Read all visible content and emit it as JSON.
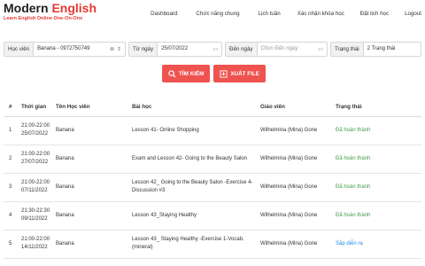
{
  "brand": {
    "title_main": "Modern",
    "title_accent": "English",
    "subtitle": "Learn English Online One-On-One"
  },
  "nav": [
    {
      "label": "Dashboard"
    },
    {
      "label": "Chức năng chung"
    },
    {
      "label": "Lịch tuần"
    },
    {
      "label": "Xác nhận khóa học"
    },
    {
      "label": "Đặt lịch học"
    },
    {
      "label": "Logout"
    }
  ],
  "filters": {
    "student_label": "Học viên",
    "student_value": "Banana - 0972750749",
    "from_label": "Từ ngày",
    "from_value": "25/07/2022",
    "to_label": "Đến ngày",
    "to_placeholder": "Chọn Đến ngày",
    "status_label": "Trạng thái",
    "status_value": "2 Trạng thái"
  },
  "actions": {
    "search_label": "TÌM KIẾM",
    "export_label": "XUẤT FILE"
  },
  "table": {
    "headers": {
      "num": "#",
      "time": "Thời gian",
      "student": "Tên Học viên",
      "lesson": "Bài học",
      "teacher": "Giáo viên",
      "status": "Trạng thái"
    },
    "rows": [
      {
        "num": "1",
        "time_1": "21:00-22:00",
        "time_2": "25/07/2022",
        "student": "Banana",
        "lesson": "Lesson 41- Online Shopping",
        "teacher": "Wilhelmina (Mina) Gone",
        "status": "Đã hoàn thành",
        "status_kind": "done"
      },
      {
        "num": "2",
        "time_1": "21:00-22:00",
        "time_2": "27/07/2022",
        "student": "Banana",
        "lesson": "Exam and Lesson 42- Going to the Beauty Salon",
        "teacher": "Wilhelmina (Mina) Gone",
        "status": "Đã hoàn thành",
        "status_kind": "done"
      },
      {
        "num": "3",
        "time_1": "21:00-22:00",
        "time_2": "07/11/2022",
        "student": "Banana",
        "lesson": "Lesson 42_ Going to the Beauty Salon -Exercise 4-Discussion #3",
        "teacher": "Wilhelmina (Mina) Gone",
        "status": "Đã hoàn thành",
        "status_kind": "done"
      },
      {
        "num": "4",
        "time_1": "21:30-22:30",
        "time_2": "09/11/2022",
        "student": "Banana",
        "lesson": "Lesson 43_Staying Healthy",
        "teacher": "Wilhelmina (Mina) Gone",
        "status": "Đã hoàn thành",
        "status_kind": "done"
      },
      {
        "num": "5",
        "time_1": "21:00-22:00",
        "time_2": "14/11/2022",
        "student": "Banana",
        "lesson": "Lesson 43_ Staying Healthy -Exercise 1-Vocab. (mineral)",
        "teacher": "Wilhelmina (Mina) Gone",
        "status": "Sắp diễn ra",
        "status_kind": "upcoming"
      }
    ]
  },
  "colors": {
    "brand_red": "#e53935",
    "button_red": "#ef5350",
    "done_green": "#43a047",
    "upcoming_blue": "#1e88e5"
  }
}
